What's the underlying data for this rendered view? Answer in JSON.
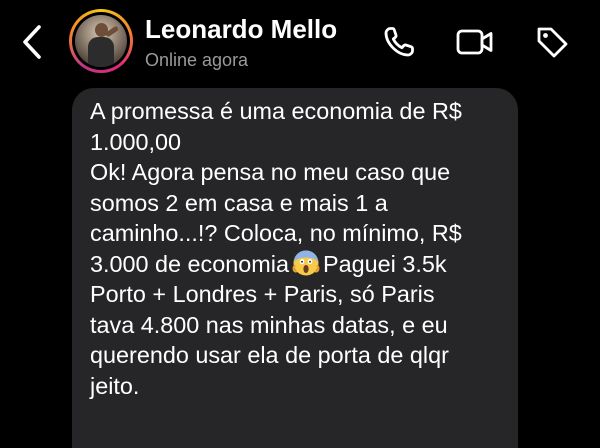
{
  "header": {
    "contact_name": "Leonardo Mello",
    "status": "Online agora",
    "icons": {
      "back": "chevron-left-icon",
      "phone": "phone-icon",
      "video": "video-camera-icon",
      "tag": "tag-icon"
    }
  },
  "message": {
    "lines": [
      "A promessa é uma economia de R$",
      "1.000,00",
      "Ok! Agora pensa no meu caso que",
      "somos 2 em casa e mais 1 a",
      "caminho...!? Coloca, no mínimo, R$",
      "3.000 de economia",
      "Paguei 3.5k",
      "Porto + Londres + Paris, só Paris",
      "tava 4.800 nas minhas datas, e eu",
      "querendo usar ela de porta de qlqr",
      "jeito."
    ],
    "emoji": "face-screaming-in-fear-emoji"
  },
  "colors": {
    "background": "#000000",
    "bubble": "#262628",
    "text": "#ffffff",
    "status_text": "#9a9a9a"
  }
}
